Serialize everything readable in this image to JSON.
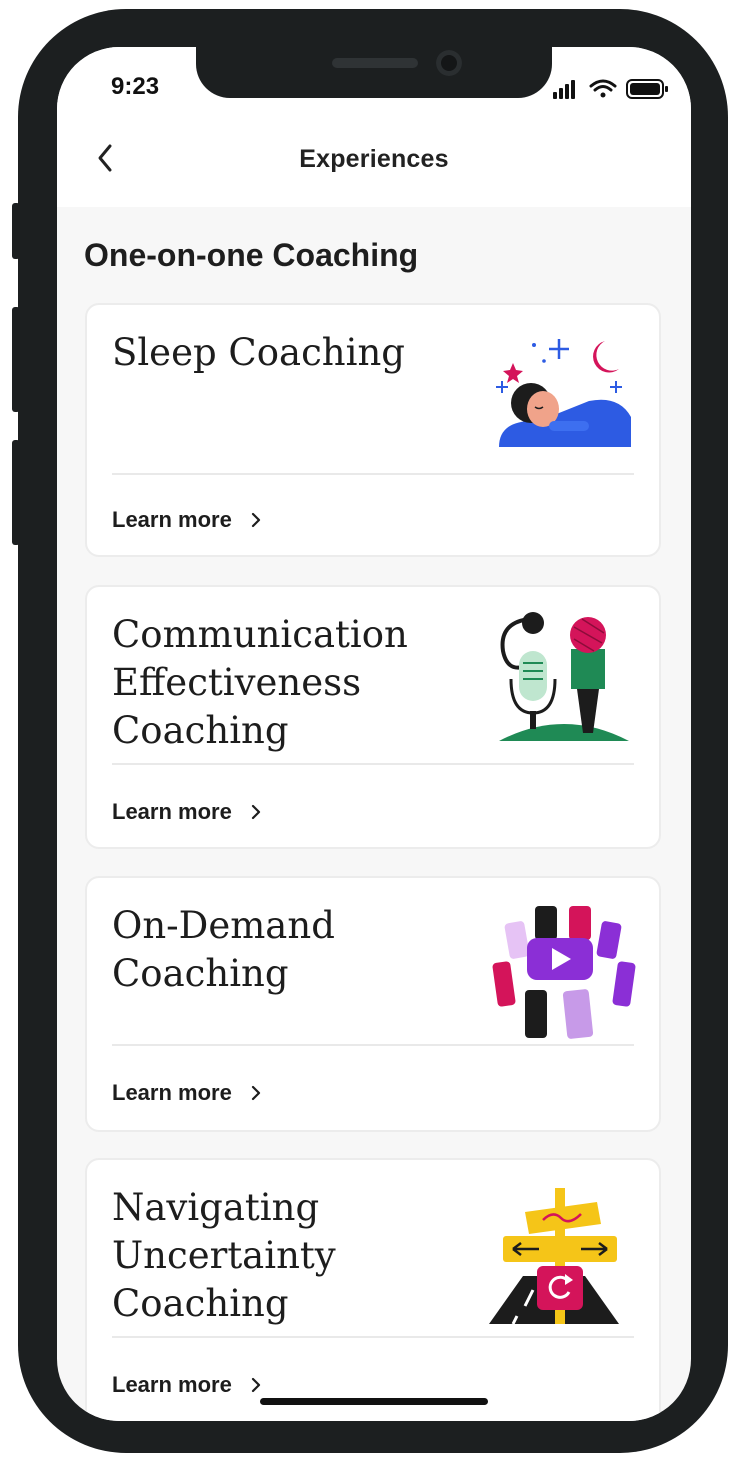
{
  "status_bar": {
    "time": "9:23"
  },
  "nav": {
    "title": "Experiences"
  },
  "section": {
    "title": "One-on-one Coaching"
  },
  "cards": [
    {
      "title": "Sleep Coaching",
      "link": "Learn more",
      "icon": "sleeping-person-illustration"
    },
    {
      "title": "Communication Effectiveness Coaching",
      "link": "Learn more",
      "icon": "microphones-illustration"
    },
    {
      "title": "On-Demand Coaching",
      "link": "Learn more",
      "icon": "video-phones-illustration"
    },
    {
      "title": "Navigating Uncertainty Coaching",
      "link": "Learn more",
      "icon": "signpost-illustration"
    }
  ],
  "colors": {
    "frame": "#1c1f20",
    "background": "#f7f7f7",
    "card": "#ffffff",
    "accent_pink": "#d4145a",
    "accent_blue": "#2d5be3",
    "accent_purple": "#8b2fd6",
    "accent_yellow": "#f5c518",
    "accent_green": "#1f8a55"
  }
}
